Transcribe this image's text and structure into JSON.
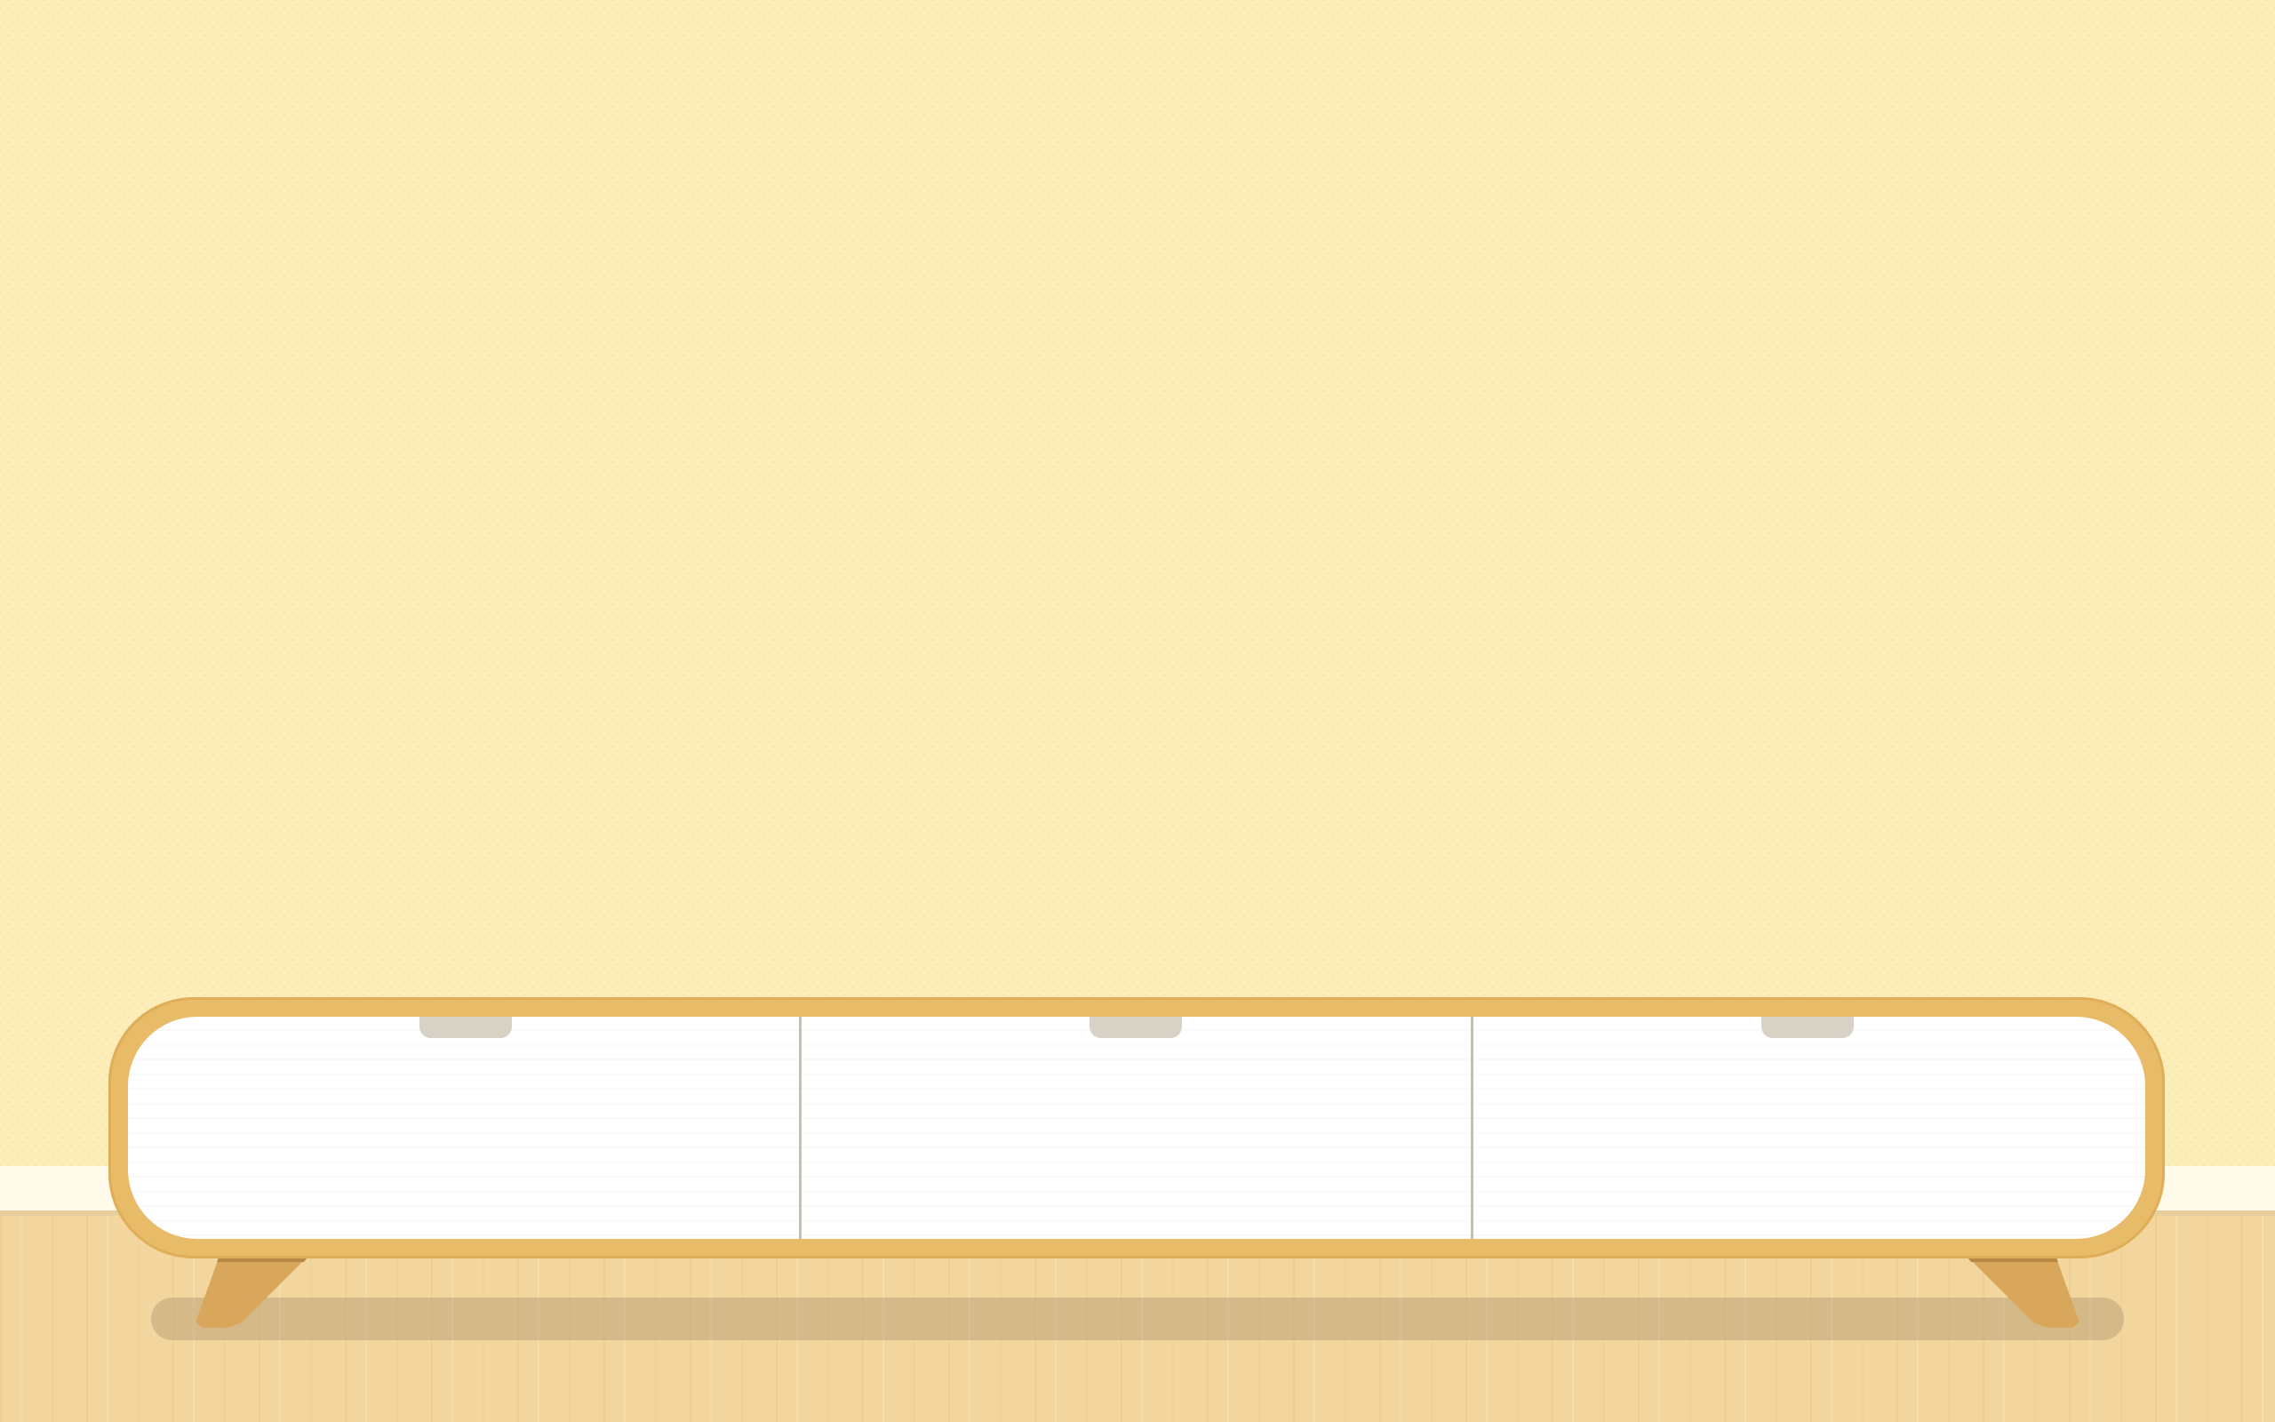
{
  "scene": {
    "description_items": [
      "wall",
      "baseboard",
      "floor",
      "tv-cabinet"
    ],
    "colors": {
      "wall": "#fdedb8",
      "baseboard": "#fffaea",
      "floor": "#f3d69d",
      "cabinet_frame": "#e8bb69",
      "cabinet_front": "#ffffff",
      "handle": "#d8d2c6",
      "leg": "#d8a75c",
      "shadow": "#c9a97a"
    },
    "cabinet": {
      "drawers": [
        {
          "icon": "drawer-handle"
        },
        {
          "icon": "drawer-handle"
        },
        {
          "icon": "drawer-handle"
        }
      ],
      "legs": 2
    }
  }
}
